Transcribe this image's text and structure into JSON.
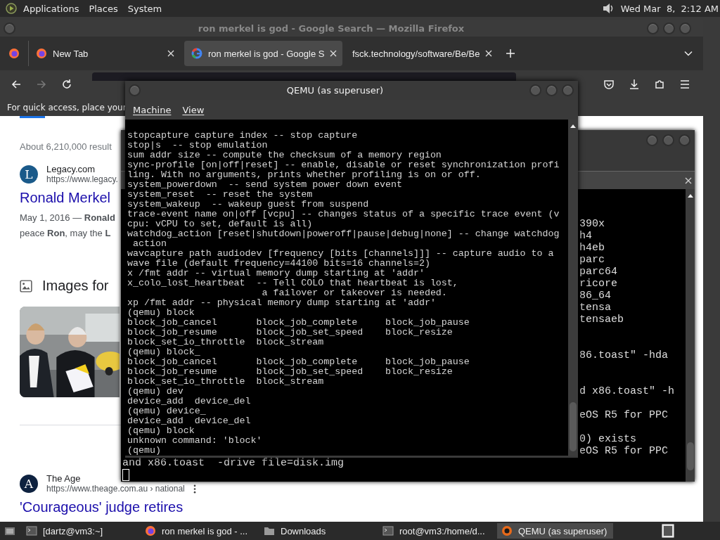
{
  "top_panel": {
    "menus": [
      "Applications",
      "Places",
      "System"
    ],
    "clock": "Wed Mar  8,  2:12 AM"
  },
  "browser": {
    "title": "ron merkel is god - Google Search — Mozilla Firefox",
    "tabs": [
      {
        "label": "New Tab",
        "selected": false,
        "kind": "firefox"
      },
      {
        "label": "ron merkel is god - Google S",
        "selected": true,
        "kind": "google"
      },
      {
        "label": "fsck.technology/software/Be/Be",
        "selected": false,
        "kind": "plain"
      }
    ],
    "bookmarks_hint": "For quick access, place your",
    "result_count": "About 6,210,000 result",
    "results": [
      {
        "logo_letter": "L",
        "color": "#1a5a8a",
        "source": "Legacy.com",
        "url": "https://www.legacy.",
        "title": "Ronald Merkel",
        "snippet": [
          "May 1, 2016 — **Ronald**",
          "peace **Ron**, may the **L**"
        ]
      }
    ],
    "images_heading": "Images for",
    "later_results": [
      {
        "logo_letter": "A",
        "color": "#0e2240",
        "source": "The Age",
        "url": "https://www.theage.com.au › national",
        "title": "'Courageous' judge retires"
      }
    ]
  },
  "terminal_window": {
    "lines": [
      "390x",
      "h4",
      "h4eb",
      "parc",
      "parc64",
      "ricore",
      "86_64",
      "tensa",
      "tensaeb",
      "86.toast\" -hda",
      "d x86.toast\" -h",
      "eOS R5 for PPC",
      "0) exists",
      "eOS R5 for PPC"
    ],
    "bottom_line": "and x86.toast  -drive file=disk.img"
  },
  "qemu": {
    "title": "QEMU (as superuser)",
    "menus": [
      "Machine",
      "View"
    ],
    "lines": [
      "stopcapture capture index -- stop capture",
      "stop|s  -- stop emulation",
      "sum addr size -- compute the checksum of a memory region",
      "sync-profile [on|off|reset] -- enable, disable or reset synchronization profi",
      "ling. With no arguments, prints whether profiling is on or off.",
      "system_powerdown  -- send system power down event",
      "system_reset  -- reset the system",
      "system_wakeup  -- wakeup guest from suspend",
      "trace-event name on|off [vcpu] -- changes status of a specific trace event (v",
      "cpu: vCPU to set, default is all)",
      "watchdog_action [reset|shutdown|poweroff|pause|debug|none] -- change watchdog",
      " action",
      "wavcapture path audiodev [frequency [bits [channels]]] -- capture audio to a",
      "wave file (default frequency=44100 bits=16 channels=2)",
      "x /fmt addr -- virtual memory dump starting at 'addr'",
      "x_colo_lost_heartbeat  -- Tell COLO that heartbeat is lost,",
      "                        a failover or takeover is needed.",
      "xp /fmt addr -- physical memory dump starting at 'addr'",
      "(qemu) block",
      "block_job_cancel       block_job_complete     block_job_pause",
      "block_job_resume       block_job_set_speed    block_resize",
      "block_set_io_throttle  block_stream",
      "(qemu) block_",
      "block_job_cancel       block_job_complete     block_job_pause",
      "block_job_resume       block_job_set_speed    block_resize",
      "block_set_io_throttle  block_stream",
      "(qemu) dev",
      "device_add  device_del",
      "(qemu) device_",
      "device_add  device_del",
      "(qemu) block",
      "unknown command: 'block'",
      "(qemu)"
    ]
  },
  "taskbar": {
    "items": [
      {
        "label": "[dartz@vm3:~]",
        "kind": "terminal",
        "selected": false
      },
      {
        "label": "ron merkel is god - ...",
        "kind": "firefox",
        "selected": false
      },
      {
        "label": "Downloads",
        "kind": "folder",
        "selected": false
      },
      {
        "label": "root@vm3:/home/d...",
        "kind": "terminal",
        "selected": false
      },
      {
        "label": "QEMU (as superuser)",
        "kind": "qemu",
        "selected": true
      }
    ]
  }
}
